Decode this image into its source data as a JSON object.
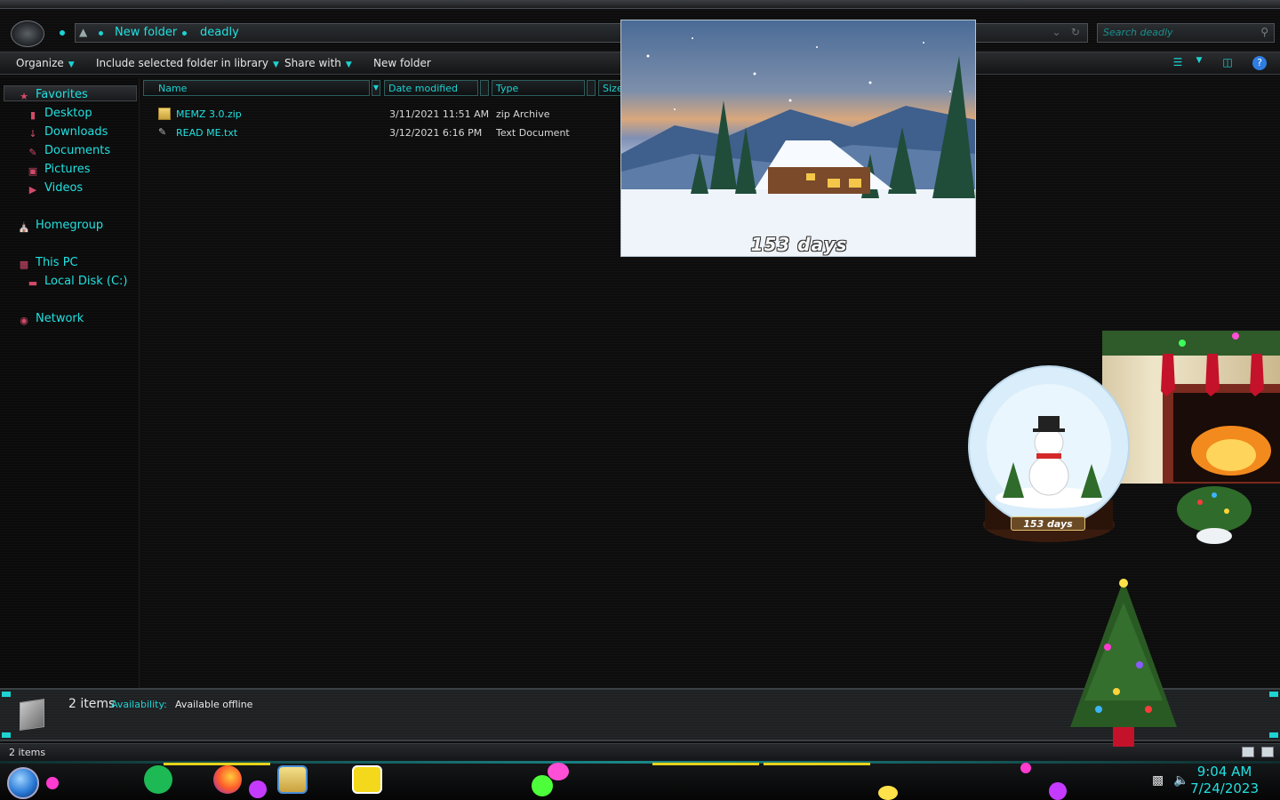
{
  "window": {
    "breadcrumb": [
      "New folder",
      "deadly"
    ],
    "search_placeholder": "Search deadly"
  },
  "toolbar": {
    "organize": "Organize",
    "include_library": "Include selected folder in library",
    "share_with": "Share with",
    "new_folder": "New folder"
  },
  "nav": {
    "favorites": "Favorites",
    "desktop": "Desktop",
    "downloads": "Downloads",
    "documents": "Documents",
    "pictures": "Pictures",
    "videos": "Videos",
    "homegroup": "Homegroup",
    "this_pc": "This PC",
    "local_disk": "Local Disk (C:)",
    "network": "Network"
  },
  "columns": {
    "name": "Name",
    "date_modified": "Date modified",
    "type": "Type",
    "size": "Size"
  },
  "files": [
    {
      "name": "MEMZ 3.0.zip",
      "date": "3/11/2021 11:51 AM",
      "type": "zip Archive"
    },
    {
      "name": "READ ME.txt",
      "date": "3/12/2021 6:16 PM",
      "type": "Text Document"
    }
  ],
  "details": {
    "count": "2 items",
    "availability_label": "Availability:",
    "availability_value": "Available offline"
  },
  "status": {
    "text": "2 items"
  },
  "taskbar": {
    "time": "9:04 AM",
    "date": "7/24/2023"
  },
  "gadgets": {
    "countdown_large": "153  days",
    "countdown_small": "153  days"
  },
  "colors": {
    "accent": "#1dd3d3",
    "text": "#e6e6e6",
    "background": "#0d0d0d"
  }
}
